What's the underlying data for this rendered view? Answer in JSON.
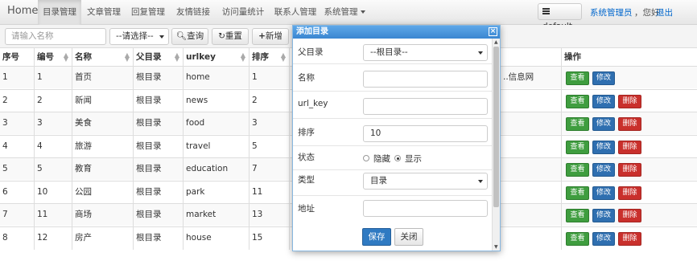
{
  "navbar": {
    "brand": "Home",
    "items": [
      "目录管理",
      "文章管理",
      "回复管理",
      "友情链接",
      "访问量统计",
      "联系人管理",
      "系统管理"
    ],
    "theme": "default",
    "user_link": "系统管理员",
    "greeting": "，您好",
    "logout": "退出"
  },
  "toolbar": {
    "name_placeholder": "请输入名称",
    "select_value": "--请选择--",
    "query": "查询",
    "reset": "重置",
    "add": "新增"
  },
  "table": {
    "columns": [
      "序号",
      "编号",
      "名称",
      "父目录",
      "urlkey",
      "排序",
      "",
      "",
      "",
      "操作"
    ],
    "rows": [
      {
        "seq": "1",
        "id": "1",
        "name": "首页",
        "parent": "根目录",
        "urlkey": "home",
        "sort": "1",
        "extra": "..信息网",
        "delete": false
      },
      {
        "seq": "2",
        "id": "2",
        "name": "新闻",
        "parent": "根目录",
        "urlkey": "news",
        "sort": "2",
        "extra": "",
        "delete": true
      },
      {
        "seq": "3",
        "id": "3",
        "name": "美食",
        "parent": "根目录",
        "urlkey": "food",
        "sort": "3",
        "extra": "",
        "delete": true
      },
      {
        "seq": "4",
        "id": "4",
        "name": "旅游",
        "parent": "根目录",
        "urlkey": "travel",
        "sort": "5",
        "extra": "",
        "delete": true
      },
      {
        "seq": "5",
        "id": "5",
        "name": "教育",
        "parent": "根目录",
        "urlkey": "education",
        "sort": "7",
        "extra": "",
        "delete": true
      },
      {
        "seq": "6",
        "id": "10",
        "name": "公园",
        "parent": "根目录",
        "urlkey": "park",
        "sort": "11",
        "extra": "",
        "delete": true
      },
      {
        "seq": "7",
        "id": "11",
        "name": "商场",
        "parent": "根目录",
        "urlkey": "market",
        "sort": "13",
        "extra": "",
        "delete": true
      },
      {
        "seq": "8",
        "id": "12",
        "name": "房产",
        "parent": "根目录",
        "urlkey": "house",
        "sort": "15",
        "extra": "",
        "delete": true
      }
    ],
    "actions": {
      "view": "查看",
      "edit": "修改",
      "delete": "删除"
    }
  },
  "modal": {
    "title": "添加目录",
    "fields": {
      "parent_label": "父目录",
      "parent_value": "--根目录--",
      "name_label": "名称",
      "urlkey_label": "url_key",
      "sort_label": "排序",
      "sort_value": "10",
      "status_label": "状态",
      "status_hide": "隐藏",
      "status_show": "显示",
      "type_label": "类型",
      "type_value": "目录",
      "address_label": "地址"
    },
    "save": "保存",
    "close": "关闭"
  }
}
